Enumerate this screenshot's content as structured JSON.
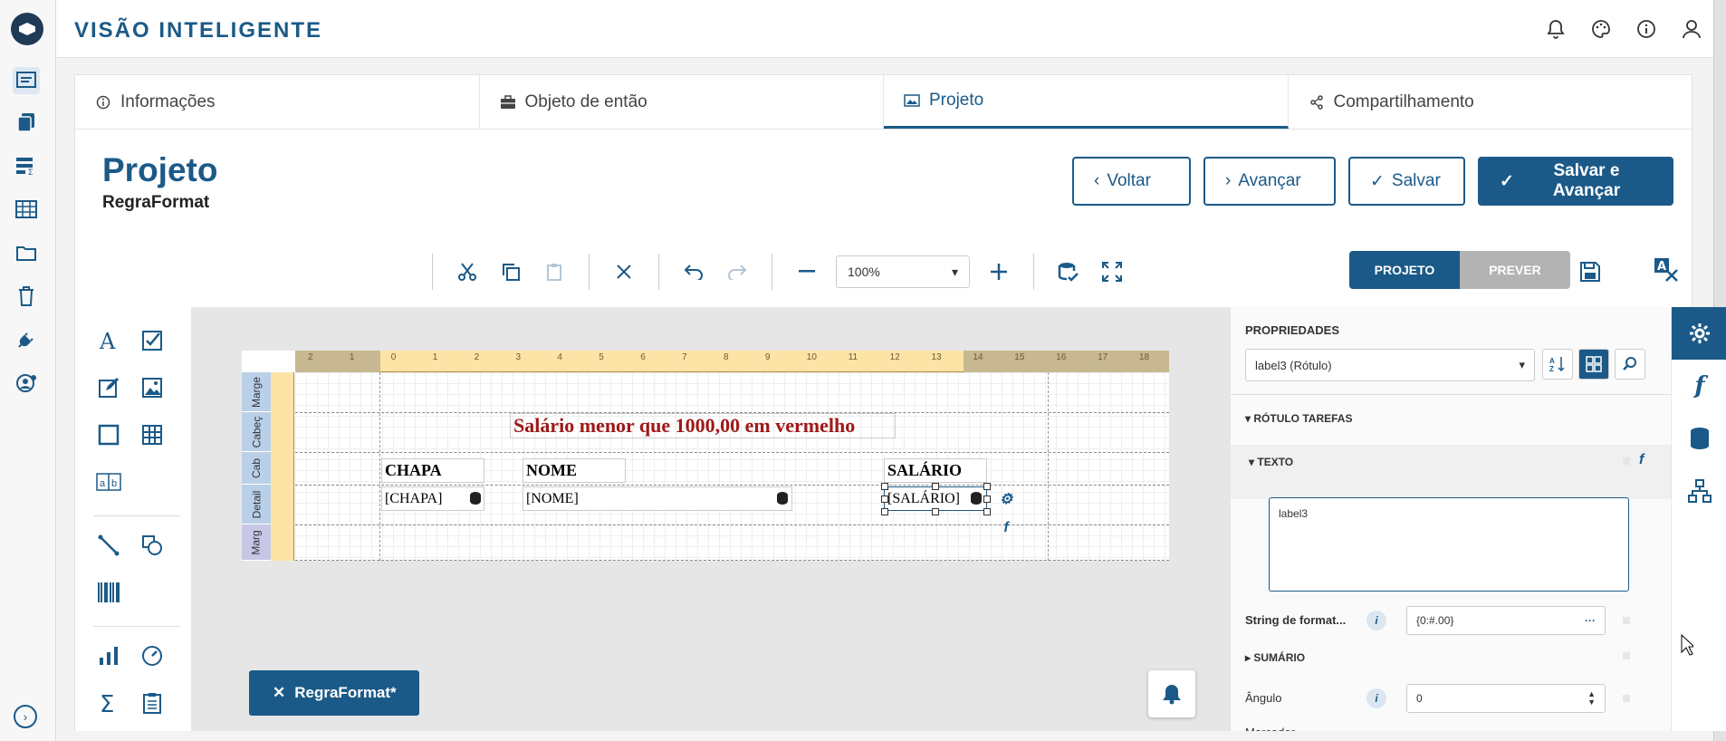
{
  "app": {
    "brand": "VISÃO INTELIGENTE"
  },
  "header_icons": [
    "bell-icon",
    "palette-icon",
    "info-icon",
    "user-icon"
  ],
  "rail": [
    "report-icon",
    "documents-icon",
    "list-sum-icon",
    "table-icon",
    "folder-icon",
    "trash-icon",
    "plug-icon",
    "user-settings-icon"
  ],
  "tabs": [
    {
      "label": "Informações",
      "icon": "info-icon"
    },
    {
      "label": "Objeto de então",
      "icon": "briefcase-icon"
    },
    {
      "label": "Projeto",
      "icon": "image-icon"
    },
    {
      "label": "Compartilhamento",
      "icon": "share-icon"
    }
  ],
  "page": {
    "title": "Projeto",
    "subtitle": "RegraFormat"
  },
  "actions": {
    "back": "Voltar",
    "next": "Avançar",
    "save": "Salvar",
    "save_next": "Salvar e Avançar"
  },
  "toolbar": {
    "zoom": "100%",
    "mode_design": "PROJETO",
    "mode_preview": "PREVER"
  },
  "report": {
    "ruler_numbers": [
      "2",
      "1",
      "0",
      "1",
      "2",
      "3",
      "4",
      "5",
      "6",
      "7",
      "8",
      "9",
      "10",
      "11",
      "12",
      "13",
      "14",
      "15",
      "16",
      "17",
      "18"
    ],
    "bands": [
      "Marge",
      "Cabeç",
      "Cab",
      "Detail",
      "Marg"
    ],
    "title": "Salário menor que 1000,00 em vermelho",
    "headers": [
      "CHAPA",
      "NOME",
      "SALÁRIO"
    ],
    "fields": [
      "[CHAPA]",
      "[NOME]",
      "[SALÁRIO]"
    ]
  },
  "chip": {
    "label": "RegraFormat*"
  },
  "properties": {
    "heading": "PROPRIEDADES",
    "selected": "label3 (Rótulo)",
    "tasks": "RÓTULO TAREFAS",
    "text_section": "TEXTO",
    "text_value": "label3",
    "format_label": "String de format...",
    "format_value": "{0:#.00}",
    "summary": "SUMÁRIO",
    "angle_label": "Ângulo",
    "angle_value": "0",
    "marker_label": "Marcador"
  },
  "colors": {
    "primary": "#1b5a88",
    "title_red": "#a01818"
  }
}
